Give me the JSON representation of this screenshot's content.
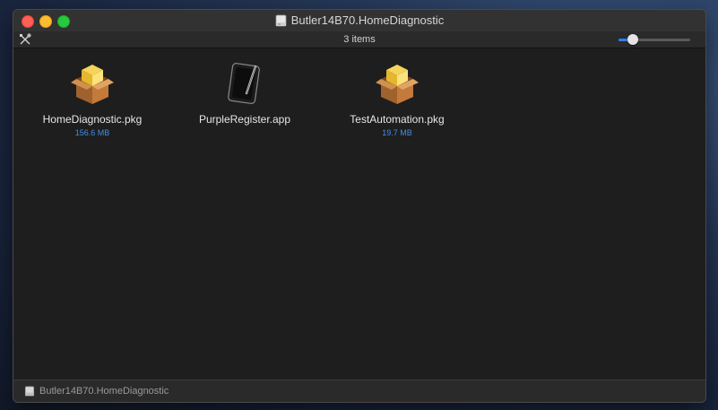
{
  "window": {
    "title": "Butler14B70.HomeDiagnostic"
  },
  "toolbar": {
    "item_count": "3 items",
    "icon_size_slider": 0.2
  },
  "files": [
    {
      "name": "HomeDiagnostic.pkg",
      "size": "156.6 MB",
      "icon": "package-icon"
    },
    {
      "name": "PurpleRegister.app",
      "size": "",
      "icon": "app-tablet-icon"
    },
    {
      "name": "TestAutomation.pkg",
      "size": "19.7 MB",
      "icon": "package-icon"
    }
  ],
  "pathbar": {
    "label": "Butler14B70.HomeDiagnostic"
  },
  "colors": {
    "close": "#fe5f57",
    "minimize": "#febc2e",
    "maximize": "#28c840",
    "size_text": "#3f8fe8"
  }
}
